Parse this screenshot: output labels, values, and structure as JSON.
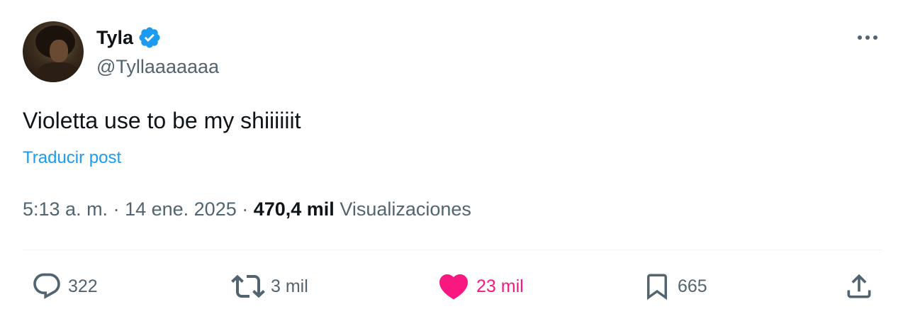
{
  "author": {
    "name": "Tyla",
    "handle": "@Tyllaaaaaaa",
    "verified": true,
    "verified_color": "#1d9bf0"
  },
  "post": {
    "text": "Violetta use to be my shiiiiiit",
    "translate_label": "Traducir post"
  },
  "meta": {
    "time": "5:13 a. m.",
    "sep1": " · ",
    "date": "14 ene. 2025",
    "sep2": " · ",
    "views_count": "470,4 mil",
    "views_label": " Visualizaciones"
  },
  "actions": {
    "replies": "322",
    "reposts": "3 mil",
    "likes": "23 mil",
    "bookmarks": "665"
  },
  "colors": {
    "text": "#0f1419",
    "secondary": "#536471",
    "link": "#1d9bf0",
    "like": "#f91880"
  },
  "icons": {
    "reply": "reply-icon",
    "repost": "repost-icon",
    "like": "heart-icon",
    "bookmark": "bookmark-icon",
    "share": "share-icon",
    "more": "more-icon",
    "verified": "verified-badge-icon"
  }
}
